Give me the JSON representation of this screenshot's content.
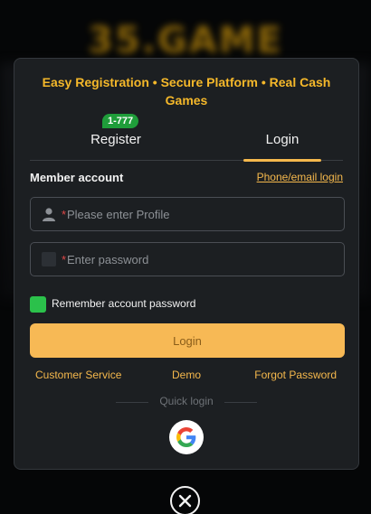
{
  "backdrop": {
    "brand": "35.GAME"
  },
  "modal": {
    "tagline": "Easy Registration • Secure Platform • Real Cash Games",
    "tabs": [
      {
        "label": "Register",
        "badge": "1-777",
        "active": false
      },
      {
        "label": "Login",
        "active": true
      }
    ],
    "member_account_label": "Member account",
    "phone_email_link": "Phone/email login",
    "profile_field": {
      "required_mark": "*",
      "placeholder": "Please enter Profile",
      "value": "",
      "icon": "user-icon"
    },
    "password_field": {
      "required_mark": "*",
      "placeholder": "Enter password",
      "value": "",
      "icon": "lock-icon"
    },
    "remember_label": "Remember account password",
    "remember_checked": true,
    "login_button": "Login",
    "links": {
      "customer_service": "Customer Service",
      "demo": "Demo",
      "forgot_password": "Forgot Password"
    },
    "quick_login_label": "Quick login",
    "quick_login_providers": [
      "google-icon"
    ]
  },
  "close_icon": "close-icon",
  "colors": {
    "accent": "#f5b84c",
    "tagline": "#f5b82a",
    "badge": "#1f9d3a",
    "checkbox": "#2bc14b",
    "required": "#e04848",
    "modal_bg": "#1c1f22"
  }
}
